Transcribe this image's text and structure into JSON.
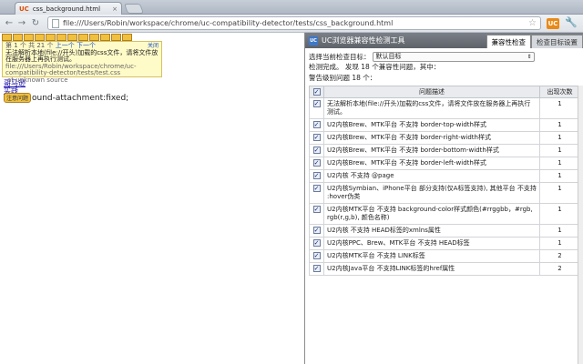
{
  "browser": {
    "tab_icon": "UC",
    "tab_title": "css_background.html",
    "tab_close": "×",
    "url": "file:///Users/Robin/workspace/chrome/uc-compatibility-detector/tests/css_background.html",
    "ext_btn": "UC"
  },
  "page": {
    "popup": {
      "nav_prefix": "第 1 个 共 21 个",
      "prev": "上一个",
      "next": "下一个",
      "close": "关闭",
      "message": "无法解析本地(file://开头)加载的css文件，请将文件放在服务器上再执行测试。",
      "path": "file:///Users/Robin/workspace/chrome/uc-compatibility-detector/tests/test.css",
      "source": "at unknown source"
    },
    "link1": "哥马逊",
    "link2": "实践",
    "badge": "注意问题",
    "line_text": "ound-attachment:fixed;"
  },
  "panel": {
    "logo": "UC",
    "title": "UC浏览器兼容性检测工具",
    "tabs": [
      {
        "label": "兼容性检查"
      },
      {
        "label": "检查目标设置"
      }
    ],
    "select_label": "选择当前检查目标：",
    "select_value": "默认目标",
    "status": "检测完成。 发现 18 个兼容性问题，其中：",
    "warn": "警告级别问题 18 个：",
    "col_desc": "问题描述",
    "col_count": "出现次数",
    "issues": [
      {
        "desc": "无法解析本地(file://开头)加载的css文件，请将文件放在服务器上再执行测试。",
        "count": "1"
      },
      {
        "desc": "U2内核Brew、MTK平台 不支持 border-top-width样式",
        "count": "1"
      },
      {
        "desc": "U2内核Brew、MTK平台 不支持 border-right-width样式",
        "count": "1"
      },
      {
        "desc": "U2内核Brew、MTK平台 不支持 border-bottom-width样式",
        "count": "1"
      },
      {
        "desc": "U2内核Brew、MTK平台 不支持 border-left-width样式",
        "count": "1"
      },
      {
        "desc": "U2内核 不支持 @page",
        "count": "1"
      },
      {
        "desc": "U2内核Symbian、iPhone平台 部分支持(仅A标签支持), 其他平台 不支持 :hover伪类",
        "count": "1"
      },
      {
        "desc": "U2内核MTK平台 不支持 background-color样式颜色(#rrggbb，#rgb, rgb(r,g,b), 颜色名称)",
        "count": "1"
      },
      {
        "desc": "U2内核 不支持 HEAD标签的xmlns属性",
        "count": "1"
      },
      {
        "desc": "U2内核PPC、Brew、MTK平台 不支持 HEAD标签",
        "count": "1"
      },
      {
        "desc": "U2内核MTK平台 不支持 LINK标签",
        "count": "2"
      },
      {
        "desc": "U2内核Java平台 不支持LINK标签的href属性",
        "count": "2"
      }
    ]
  }
}
